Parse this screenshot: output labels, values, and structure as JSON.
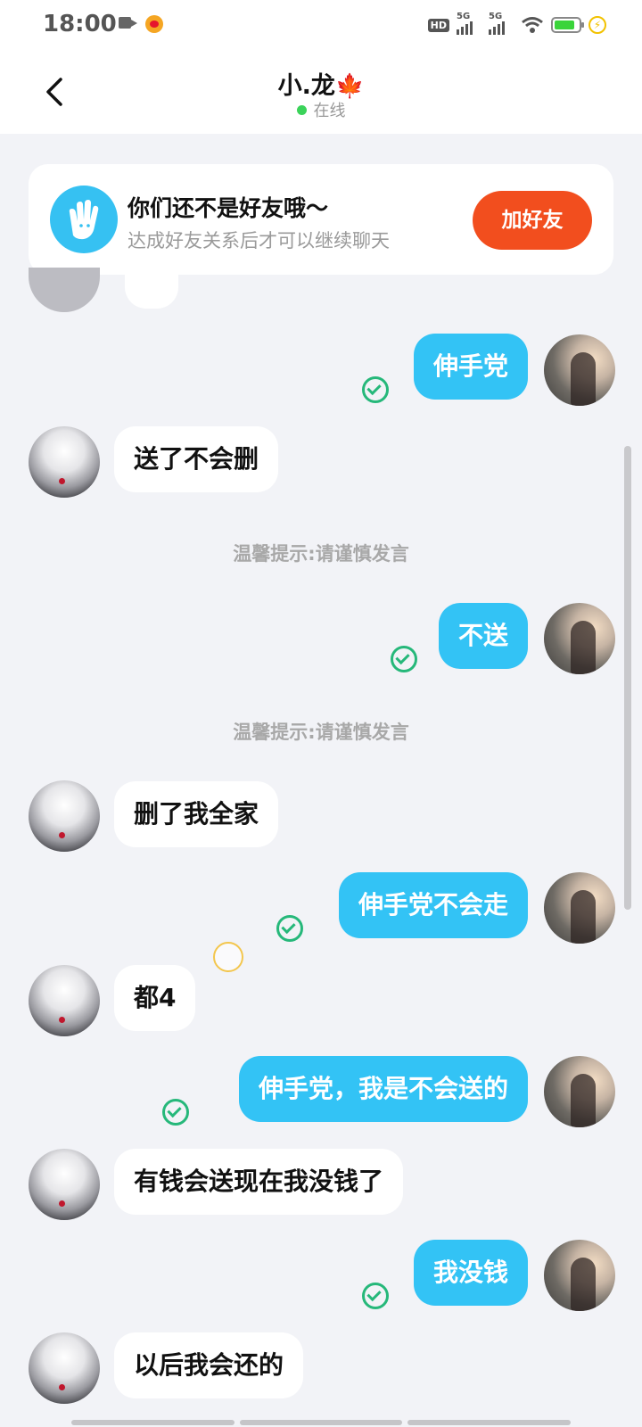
{
  "status_bar": {
    "time": "18:00",
    "hd_label": "HD",
    "sim1_label": "5G",
    "sim2_label": "5G"
  },
  "header": {
    "contact_name": "小.龙",
    "emoji": "🍁",
    "presence": "在线"
  },
  "banner": {
    "title": "你们还不是好友哦～",
    "subtitle": "达成好友关系后才可以继续聊天",
    "add_button": "加好友"
  },
  "messages": [
    {
      "from": "me",
      "text": "伸手党"
    },
    {
      "from": "other",
      "text": "送了不会删"
    },
    {
      "tip": "温馨提示:请谨慎发言"
    },
    {
      "from": "me",
      "text": "不送"
    },
    {
      "tip": "温馨提示:请谨慎发言"
    },
    {
      "from": "other",
      "text": "删了我全家"
    },
    {
      "from": "me",
      "text": "伸手党不会走"
    },
    {
      "from": "other",
      "text": "都4"
    },
    {
      "from": "me",
      "text": "伸手党，我是不会送的"
    },
    {
      "from": "other",
      "text": "有钱会送现在我没钱了"
    },
    {
      "from": "me",
      "text": "我没钱"
    },
    {
      "from": "other",
      "text": "以后我会还的"
    }
  ],
  "colors": {
    "sent_bubble": "#33c3f5",
    "add_button": "#f24e1e",
    "online_dot": "#3bd35a",
    "read_check": "#26b87a"
  }
}
